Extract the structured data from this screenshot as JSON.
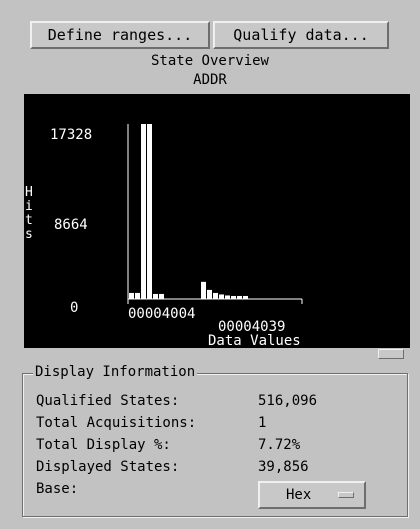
{
  "toolbar": {
    "define_ranges_label": "Define ranges...",
    "qualify_data_label": "Qualify data..."
  },
  "chart_header": {
    "title": "State Overview",
    "subtitle": "ADDR"
  },
  "chart_data": {
    "type": "bar",
    "title": "State Overview",
    "subtitle": "ADDR",
    "ylabel": "Hits",
    "xlabel": "Data Values",
    "yticks": [
      "17328",
      "8664",
      "0"
    ],
    "ytick_values": [
      17328,
      8664,
      0
    ],
    "xticks": [
      "00004004",
      "00004039"
    ],
    "ylim": [
      0,
      17328
    ],
    "grid": false,
    "bars": [
      {
        "slot": 0,
        "value": 600
      },
      {
        "slot": 1,
        "value": 600
      },
      {
        "slot": 2,
        "value": 17328
      },
      {
        "slot": 3,
        "value": 17328
      },
      {
        "slot": 4,
        "value": 500
      },
      {
        "slot": 5,
        "value": 500
      },
      {
        "slot": 12,
        "value": 1700
      },
      {
        "slot": 13,
        "value": 900
      },
      {
        "slot": 14,
        "value": 600
      },
      {
        "slot": 15,
        "value": 450
      },
      {
        "slot": 16,
        "value": 350
      },
      {
        "slot": 17,
        "value": 300
      },
      {
        "slot": 18,
        "value": 300
      },
      {
        "slot": 19,
        "value": 300
      }
    ],
    "colors": {
      "background": "#000000",
      "bars": "#ffffff",
      "text": "#ffffff"
    }
  },
  "display_info": {
    "legend": "Display Information",
    "rows": [
      {
        "label": "Qualified States:",
        "value": "516,096"
      },
      {
        "label": "Total Acquisitions:",
        "value": "1"
      },
      {
        "label": "Total Display %:",
        "value": "7.72%"
      },
      {
        "label": "Displayed States:",
        "value": "39,856"
      },
      {
        "label": "Base:",
        "value": ""
      }
    ],
    "base_select": {
      "value": "Hex"
    }
  }
}
